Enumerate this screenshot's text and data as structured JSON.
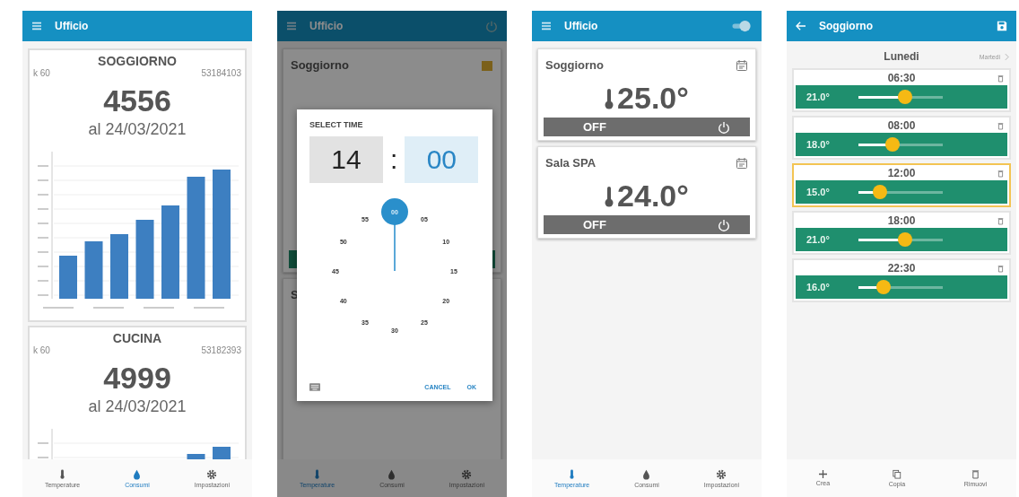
{
  "phones": [
    {
      "kind": "consumption",
      "header": {
        "title": "Ufficio"
      },
      "meters": [
        {
          "name": "SOGGIORNO",
          "k": "k 60",
          "serial": "53184103",
          "value": "4556",
          "date": "al 24/03/2021"
        },
        {
          "name": "CUCINA",
          "k": "k 60",
          "serial": "53182393",
          "value": "4999",
          "date": "al 24/03/2021"
        }
      ],
      "nav": [
        {
          "label": "Temperature",
          "selected": false
        },
        {
          "label": "Consumi",
          "selected": true
        },
        {
          "label": "Impostazioni",
          "selected": false
        }
      ]
    },
    {
      "kind": "time_picker",
      "header": {
        "title": "Ufficio"
      },
      "cards": [
        {
          "name": "Soggiorno"
        },
        {
          "name": "S"
        }
      ],
      "dialog": {
        "title": "SELECT TIME",
        "separator": ":",
        "fields": [
          {
            "value": "14",
            "selected": false
          },
          {
            "value": "00",
            "selected": true
          }
        ],
        "dial": [
          {
            "label": "00",
            "selected": true
          },
          {
            "label": "05",
            "selected": false
          },
          {
            "label": "10",
            "selected": false
          },
          {
            "label": "15",
            "selected": false
          },
          {
            "label": "20",
            "selected": false
          },
          {
            "label": "25",
            "selected": false
          },
          {
            "label": "30",
            "selected": false
          },
          {
            "label": "35",
            "selected": false
          },
          {
            "label": "40",
            "selected": false
          },
          {
            "label": "45",
            "selected": false
          },
          {
            "label": "50",
            "selected": false
          },
          {
            "label": "55",
            "selected": false
          }
        ],
        "buttons": [
          "CANCEL",
          "OK"
        ]
      },
      "nav": [
        {
          "label": "Temperature",
          "selected": true
        },
        {
          "label": "Consumi",
          "selected": false
        },
        {
          "label": "Impostazioni",
          "selected": false
        }
      ]
    },
    {
      "kind": "thermostats",
      "header": {
        "title": "Ufficio"
      },
      "thermostats": [
        {
          "name": "Soggiorno",
          "temperature": "25.0°",
          "mode": "OFF"
        },
        {
          "name": "Sala SPA",
          "temperature": "24.0°",
          "mode": "OFF"
        }
      ],
      "nav": [
        {
          "label": "Temperature",
          "selected": true
        },
        {
          "label": "Consumi",
          "selected": false
        },
        {
          "label": "Impostazioni",
          "selected": false
        }
      ]
    },
    {
      "kind": "schedule",
      "header": {
        "title": "Soggiorno"
      },
      "day": "Lunedi",
      "next_day": "Martedi",
      "slots": [
        {
          "time": "06:30",
          "temperature": "21.0°",
          "level": 0.55,
          "selected": false
        },
        {
          "time": "08:00",
          "temperature": "18.0°",
          "level": 0.4,
          "selected": false
        },
        {
          "time": "12:00",
          "temperature": "15.0°",
          "level": 0.25,
          "selected": true
        },
        {
          "time": "18:00",
          "temperature": "21.0°",
          "level": 0.55,
          "selected": false
        },
        {
          "time": "22:30",
          "temperature": "16.0°",
          "level": 0.3,
          "selected": false
        }
      ],
      "actions": [
        "Crea",
        "Copia",
        "Rimuovi"
      ]
    }
  ]
}
